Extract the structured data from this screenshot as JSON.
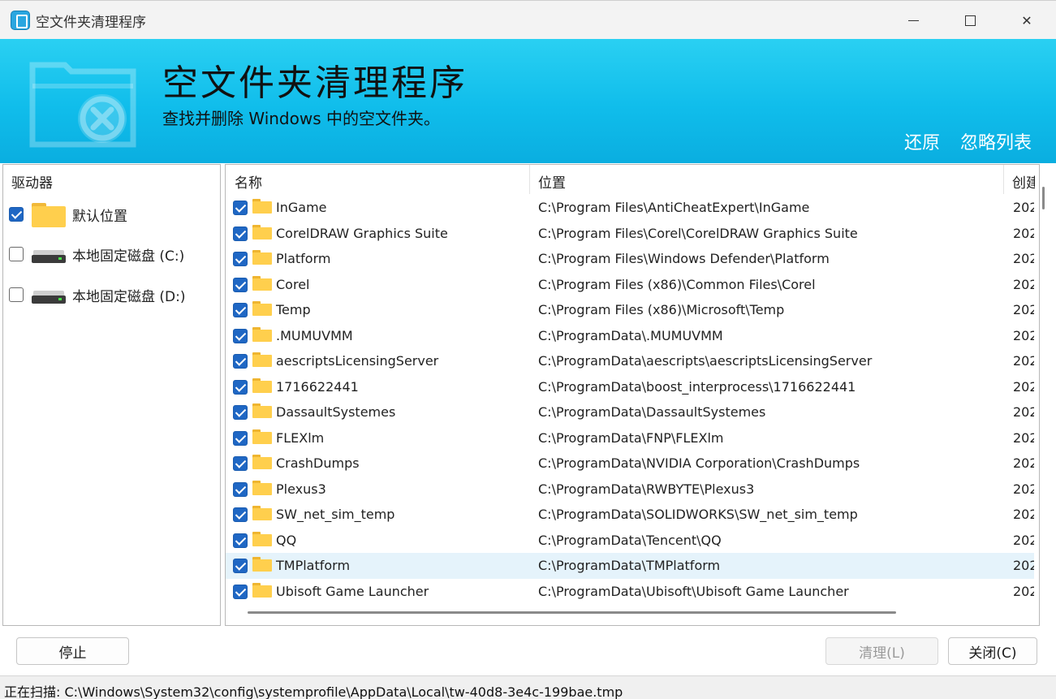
{
  "window": {
    "title": "空文件夹清理程序",
    "close_glyph": "✕"
  },
  "banner": {
    "title": "空文件夹清理程序",
    "subtitle": "查找并删除 Windows 中的空文件夹。",
    "restore_label": "还原",
    "ignore_label": "忽略列表"
  },
  "left": {
    "header": "驱动器",
    "drives": [
      {
        "label": "默认位置",
        "checked": true,
        "icon": "folder-icon"
      },
      {
        "label": "本地固定磁盘 (C:)",
        "checked": false,
        "icon": "hard-drive-icon"
      },
      {
        "label": "本地固定磁盘 (D:)",
        "checked": false,
        "icon": "hard-drive-icon"
      }
    ]
  },
  "list": {
    "columns": {
      "name": "名称",
      "location": "位置",
      "created": "创建"
    },
    "rows": [
      {
        "name": "InGame",
        "location": "C:\\Program Files\\AntiCheatExpert\\InGame",
        "date": "202"
      },
      {
        "name": "CorelDRAW Graphics Suite",
        "location": "C:\\Program Files\\Corel\\CorelDRAW Graphics Suite",
        "date": "202"
      },
      {
        "name": "Platform",
        "location": "C:\\Program Files\\Windows Defender\\Platform",
        "date": "202"
      },
      {
        "name": "Corel",
        "location": "C:\\Program Files (x86)\\Common Files\\Corel",
        "date": "202"
      },
      {
        "name": "Temp",
        "location": "C:\\Program Files (x86)\\Microsoft\\Temp",
        "date": "202"
      },
      {
        "name": ".MUMUVMM",
        "location": "C:\\ProgramData\\.MUMUVMM",
        "date": "202"
      },
      {
        "name": "aescriptsLicensingServer",
        "location": "C:\\ProgramData\\aescripts\\aescriptsLicensingServer",
        "date": "202"
      },
      {
        "name": "1716622441",
        "location": "C:\\ProgramData\\boost_interprocess\\1716622441",
        "date": "202"
      },
      {
        "name": "DassaultSystemes",
        "location": "C:\\ProgramData\\DassaultSystemes",
        "date": "202"
      },
      {
        "name": "FLEXlm",
        "location": "C:\\ProgramData\\FNP\\FLEXlm",
        "date": "202"
      },
      {
        "name": "CrashDumps",
        "location": "C:\\ProgramData\\NVIDIA Corporation\\CrashDumps",
        "date": "202"
      },
      {
        "name": "Plexus3",
        "location": "C:\\ProgramData\\RWBYTE\\Plexus3",
        "date": "202"
      },
      {
        "name": "SW_net_sim_temp",
        "location": "C:\\ProgramData\\SOLIDWORKS\\SW_net_sim_temp",
        "date": "202"
      },
      {
        "name": "QQ",
        "location": "C:\\ProgramData\\Tencent\\QQ",
        "date": "202"
      },
      {
        "name": "TMPlatform",
        "location": "C:\\ProgramData\\TMPlatform",
        "date": "202",
        "selected": true
      },
      {
        "name": "Ubisoft Game Launcher",
        "location": "C:\\ProgramData\\Ubisoft\\Ubisoft Game Launcher",
        "date": "202"
      }
    ]
  },
  "buttons": {
    "stop": "停止",
    "clean": "清理(L)",
    "close": "关闭(C)"
  },
  "status": {
    "text": "正在扫描: C:\\Windows\\System32\\config\\systemprofile\\AppData\\Local\\tw-40d8-3e4c-199bae.tmp"
  },
  "colors": {
    "banner_top": "#2ad0f2",
    "banner_bottom": "#0aaee0",
    "checkbox": "#1f67c4",
    "folder": "#ffcf4d",
    "selected_row": "#e5f3fb"
  }
}
